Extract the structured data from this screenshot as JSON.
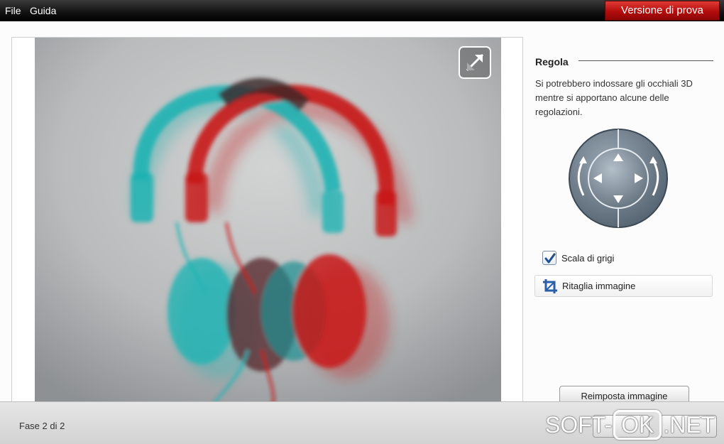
{
  "menu": {
    "file": "File",
    "help": "Guida"
  },
  "trial_badge": "Versione di prova",
  "panel": {
    "title": "Regola",
    "description": "Si potrebbero indossare gli occhiali 3D mentre si apportano alcune delle regolazioni.",
    "grayscale_label": "Scala di grigi",
    "grayscale_checked": true,
    "crop_label": "Ritaglia immagine",
    "reset_label": "Reimposta immagine"
  },
  "footer": {
    "step_text": "Fase 2 di 2"
  },
  "watermark": {
    "part1": "SOFT-",
    "part2": "OK",
    "part3": ".NET"
  },
  "colors": {
    "accent_red": "#c4110f",
    "cyan_channel": "#1fb3b3",
    "red_channel": "#c81818",
    "checkbox_check": "#1f4f8f"
  }
}
